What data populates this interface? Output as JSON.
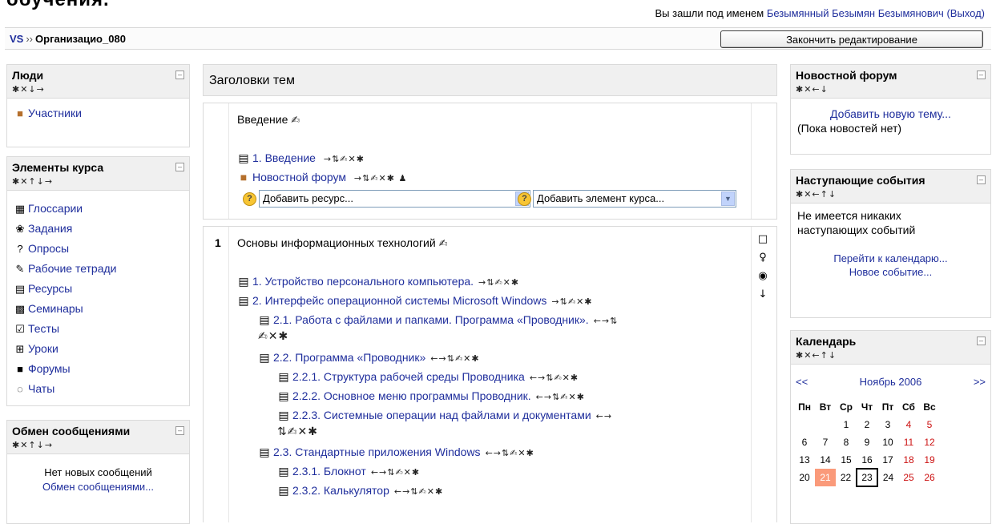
{
  "site": {
    "title": "обучения."
  },
  "header": {
    "login_prefix": "Вы зашли под именем",
    "user_name": "Безымянный Безымян Безымянович",
    "logout": "(Выход)"
  },
  "navbar": {
    "home": "VS",
    "separator": "››",
    "course": "Организацио_080",
    "edit_button": "Закончить редактирование"
  },
  "blocks": {
    "people": {
      "title": "Люди",
      "icons": "✱✕↓→",
      "items": [
        {
          "label": "Участники",
          "icon": "users-icon"
        }
      ]
    },
    "course_elements": {
      "title": "Элементы курса",
      "icons": "✱✕↑↓→",
      "items": [
        {
          "label": "Глоссарии",
          "icon": "glossary-icon",
          "glyph": "▦"
        },
        {
          "label": "Задания",
          "icon": "assignment-icon",
          "glyph": "❀"
        },
        {
          "label": "Опросы",
          "icon": "choice-icon",
          "glyph": "?"
        },
        {
          "label": "Рабочие тетради",
          "icon": "journal-icon",
          "glyph": "✎"
        },
        {
          "label": "Ресурсы",
          "icon": "resource-icon",
          "glyph": "▤"
        },
        {
          "label": "Семинары",
          "icon": "workshop-icon",
          "glyph": "▩"
        },
        {
          "label": "Тесты",
          "icon": "quiz-icon",
          "glyph": "☑"
        },
        {
          "label": "Уроки",
          "icon": "lesson-icon",
          "glyph": "⊞"
        },
        {
          "label": "Форумы",
          "icon": "forum-icon",
          "glyph": "■"
        },
        {
          "label": "Чаты",
          "icon": "chat-icon",
          "glyph": "◌"
        }
      ]
    },
    "messages": {
      "title": "Обмен сообщениями",
      "icons": "✱✕↑↓→",
      "none": "Нет новых сообщений",
      "link": "Обмен сообщениями..."
    },
    "news": {
      "title": "Новостной форум",
      "icons": "✱✕←↓",
      "add_link": "Добавить новую тему...",
      "none": "(Пока новостей нет)"
    },
    "events": {
      "title": "Наступающие события",
      "icons": "✱✕←↑↓",
      "none": "Не имеется никаких наступающих событий",
      "calendar_link": "Перейти к календарю...",
      "new_event": "Новое событие..."
    },
    "calendar": {
      "title": "Календарь",
      "icons": "✱✕←↑↓",
      "prev": "<<",
      "month": "Ноябрь 2006",
      "next": ">>",
      "weekdays": [
        "Пн",
        "Вт",
        "Ср",
        "Чт",
        "Пт",
        "Сб",
        "Вс"
      ],
      "weeks": [
        [
          "",
          "",
          "1",
          "2",
          "3",
          "4",
          "5"
        ],
        [
          "6",
          "7",
          "8",
          "9",
          "10",
          "11",
          "12"
        ],
        [
          "13",
          "14",
          "15",
          "16",
          "17",
          "18",
          "19"
        ],
        [
          "20",
          "21",
          "22",
          "23",
          "24",
          "25",
          "26"
        ]
      ],
      "today": "23",
      "event_day": "21"
    }
  },
  "main": {
    "topics_title": "Заголовки тем",
    "section0": {
      "title": "Введение",
      "edit_icon": "✍",
      "items": [
        {
          "label": "1. Введение",
          "icon": "▤",
          "tools": "→⇅✍✕✱"
        },
        {
          "label": "Новостной форум",
          "icon": "■",
          "tools": "→⇅✍✕✱ ♟"
        }
      ],
      "add_resource": "Добавить ресурс...",
      "add_activity": "Добавить элемент курса..."
    },
    "section1": {
      "number": "1",
      "title": "Основы информационных технологий",
      "edit_icon": "✍",
      "tools": [
        "□",
        "♀",
        "◉",
        "↓"
      ],
      "items": [
        {
          "label": "1. Устройство персонального компьютера.",
          "tools": "→⇅✍✕✱",
          "indent": 0
        },
        {
          "label": "2. Интерфейс операционной системы Microsoft Windows",
          "tools": "→⇅✍✕✱",
          "indent": 0
        },
        {
          "label": "2.1. Работа с файлами и папками. Программа «Проводник».",
          "tools": "←→⇅",
          "tools2": "✍✕✱",
          "indent": 1
        },
        {
          "label": "2.2. Программа «Проводник»",
          "tools": "←→⇅✍✕✱",
          "indent": 1
        },
        {
          "label": "2.2.1. Структура рабочей среды Проводника",
          "tools": "←→⇅✍✕✱",
          "indent": 2
        },
        {
          "label": "2.2.2. Основное меню программы Проводник.",
          "tools": "←→⇅✍✕✱",
          "indent": 2
        },
        {
          "label": "2.2.3. Системные операции над файлами и документами",
          "tools": "←→",
          "tools2": "⇅✍✕✱",
          "indent": 2
        },
        {
          "label": "2.3. Стандартные приложения Windows",
          "tools": "←→⇅✍✕✱",
          "indent": 1
        },
        {
          "label": "2.3.1. Блокнот",
          "tools": "←→⇅✍✕✱",
          "indent": 2
        },
        {
          "label": "2.3.2. Калькулятор",
          "tools": "←→⇅✍✕✱",
          "indent": 2
        }
      ]
    }
  },
  "colors": {
    "link": "#1f2e9c",
    "block_header": "#f0f0f0",
    "weekend": "#cc1111",
    "event_day": "#fa9a7a"
  }
}
